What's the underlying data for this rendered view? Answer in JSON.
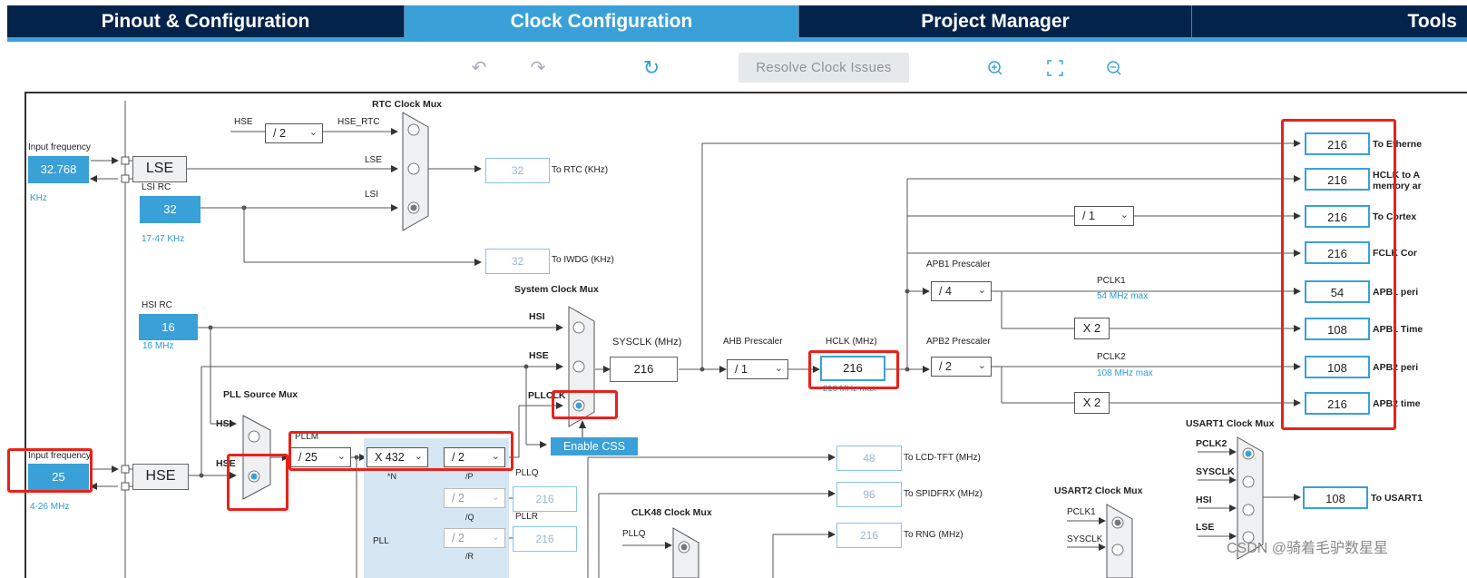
{
  "tabs": [
    {
      "label": "Pinout & Configuration",
      "active": false
    },
    {
      "label": "Clock Configuration",
      "active": true
    },
    {
      "label": "Project Manager",
      "active": false
    },
    {
      "label": "Tools",
      "active": false
    }
  ],
  "toolbar": {
    "undo_icon": "undo-icon",
    "redo_icon": "redo-icon",
    "refresh_icon": "refresh-icon",
    "resolve_label": "Resolve Clock Issues",
    "zoom_in_icon": "zoom-in-icon",
    "fit_icon": "fit-screen-icon",
    "zoom_out_icon": "zoom-out-icon"
  },
  "lse": {
    "input_label": "Input frequency",
    "input_value": "32.768",
    "unit": "KHz",
    "box_label": "LSE"
  },
  "lsi": {
    "title": "LSI RC",
    "value": "32",
    "range": "17-47 KHz"
  },
  "hsi": {
    "title": "HSI RC",
    "value": "16",
    "unit": "16 MHz"
  },
  "hse": {
    "input_label": "Input frequency",
    "input_value": "25",
    "range": "4-26 MHz",
    "box_label": "HSE"
  },
  "rtc": {
    "mux_title": "RTC Clock Mux",
    "hse_label": "HSE",
    "div_value": "/ 2",
    "hse_rtc_label": "HSE_RTC",
    "lse_label": "LSE",
    "lsi_label": "LSI",
    "rtc_out": "32",
    "rtc_out_label": "To RTC (KHz)",
    "iwdg_out": "32",
    "iwdg_out_label": "To IWDG (KHz)"
  },
  "sysmux": {
    "title": "System Clock Mux",
    "hsi": "HSI",
    "hse": "HSE",
    "pllclk": "PLLCLK",
    "sysclk_label": "SYSCLK (MHz)",
    "sysclk_value": "216",
    "enable_css": "Enable CSS"
  },
  "pllsrc": {
    "title": "PLL Source Mux",
    "hsi": "HSI",
    "hse": "HSE"
  },
  "pll": {
    "pllm_label": "PLLM",
    "pllm": "/ 25",
    "n": "X 432",
    "n_label": "*N",
    "p": "/ 2",
    "p_label": "/P",
    "q": "/ 2",
    "q_label": "/Q",
    "r": "/ 2",
    "r_label": "/R",
    "pllq_label": "PLLQ",
    "pllq_value": "216",
    "pllr_label": "PLLR",
    "pllr_value": "216",
    "pll_label": "PLL"
  },
  "ahb": {
    "title": "AHB Prescaler",
    "value": "/ 1"
  },
  "hclk": {
    "title": "HCLK (MHz)",
    "value": "216",
    "max": "216 MHz max"
  },
  "apb1": {
    "title": "APB1 Prescaler",
    "value": "/ 4",
    "pclk_label": "PCLK1",
    "pclk_max": "54 MHz max",
    "timer_mul": "X 2"
  },
  "apb2": {
    "title": "APB2 Prescaler",
    "value": "/ 2",
    "pclk_label": "PCLK2",
    "pclk_max": "108 MHz max",
    "timer_mul": "X 2"
  },
  "cortex_div": "/ 1",
  "outputs": [
    {
      "value": "216",
      "label": "To Etherne"
    },
    {
      "value": "216",
      "label": "HCLK to A",
      "label2": "memory ar"
    },
    {
      "value": "216",
      "label": "To Cortex"
    },
    {
      "value": "216",
      "label": "FCLK Cor"
    },
    {
      "value": "54",
      "label": "APB1 peri"
    },
    {
      "value": "108",
      "label": "APB1 Time"
    },
    {
      "value": "108",
      "label": "APB2 peri"
    },
    {
      "value": "216",
      "label": "APB2 time"
    }
  ],
  "peripherals": [
    {
      "value": "48",
      "label": "To LCD-TFT (MHz)"
    },
    {
      "value": "96",
      "label": "To SPIDFRX (MHz)"
    },
    {
      "value": "216",
      "label": "To RNG (MHz)"
    }
  ],
  "usart1": {
    "title": "USART1 Clock Mux",
    "in1": "PCLK2",
    "in2": "SYSCLK",
    "in3": "HSI",
    "in4": "LSE",
    "value": "108",
    "label": "To USART1"
  },
  "usart2": {
    "title": "USART2 Clock Mux",
    "in1": "PCLK1",
    "in2": "SYSCLK"
  },
  "clk48": {
    "title": "CLK48 Clock Mux",
    "in1": "PLLQ"
  },
  "watermark": "CSDN @骑着毛驴数星星",
  "colors": {
    "accent": "#3aa0d8",
    "nav": "#03234b",
    "highlight": "#e8221b"
  }
}
